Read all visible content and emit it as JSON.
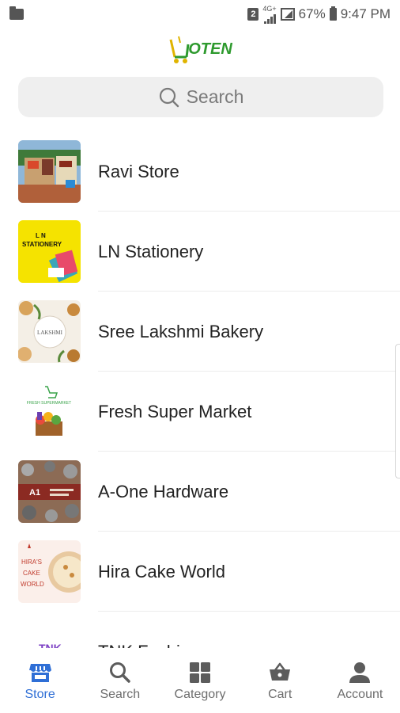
{
  "status_bar": {
    "sim": "2",
    "network": "4G+",
    "battery": "67%",
    "time": "9:47 PM",
    "icons": [
      "folder-icon",
      "sim-icon",
      "signal-icon",
      "battery-icon"
    ]
  },
  "app": {
    "logo_text": "OTEN"
  },
  "search": {
    "placeholder": "Search"
  },
  "stores": [
    {
      "name": "Ravi Store"
    },
    {
      "name": "LN Stationery",
      "thumb_text_line1": "L N",
      "thumb_text_line2": "STATIONERY"
    },
    {
      "name": "Sree Lakshmi Bakery",
      "thumb_text": "LAKSHMI"
    },
    {
      "name": "Fresh Super Market",
      "thumb_text": "FRESH SUPERMARKET"
    },
    {
      "name": "A-One Hardware",
      "thumb_text": "A1"
    },
    {
      "name": "Hira Cake World",
      "thumb_text_line1": "HIRA'S",
      "thumb_text_line2": "CAKE",
      "thumb_text_line3": "WORLD"
    },
    {
      "name": "TNK Fashions",
      "thumb_text": "TNK"
    }
  ],
  "bottom_nav": [
    {
      "label": "Store",
      "icon": "store-icon",
      "active": true
    },
    {
      "label": "Search",
      "icon": "search-icon",
      "active": false
    },
    {
      "label": "Category",
      "icon": "category-grid-icon",
      "active": false
    },
    {
      "label": "Cart",
      "icon": "basket-icon",
      "active": false
    },
    {
      "label": "Account",
      "icon": "account-icon",
      "active": false
    }
  ],
  "colors": {
    "accent": "#2f6fd6",
    "logo_green": "#2e9a2e",
    "logo_yellow": "#e0b400",
    "search_bg": "#efefef"
  }
}
